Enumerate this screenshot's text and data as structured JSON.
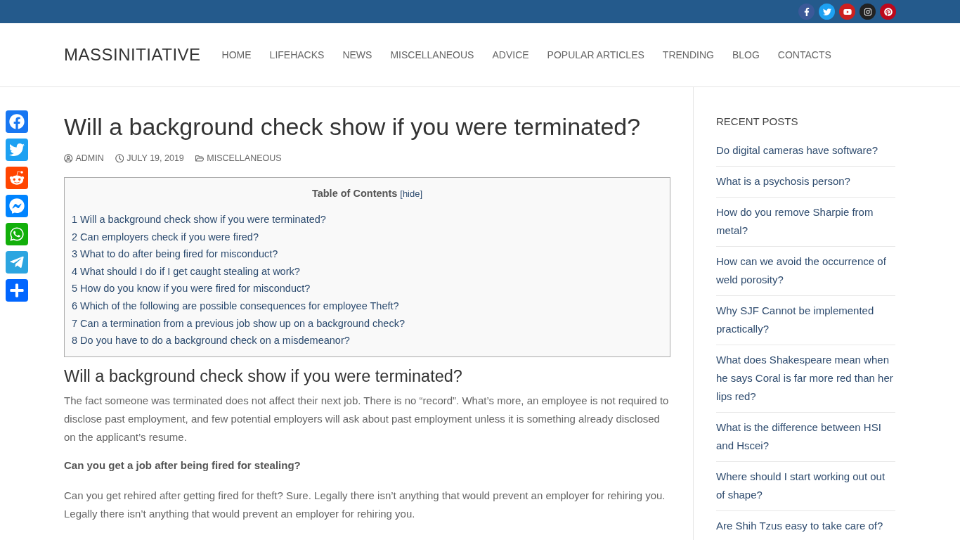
{
  "top_bar": {
    "social_links": [
      {
        "kind": "facebook"
      },
      {
        "kind": "twitter"
      },
      {
        "kind": "youtube"
      },
      {
        "kind": "instagram"
      },
      {
        "kind": "pinterest"
      }
    ]
  },
  "header": {
    "logo": "MASSINITIATIVE",
    "nav": [
      "HOME",
      "LIFEHACKS",
      "NEWS",
      "MISCELLANEOUS",
      "ADVICE",
      "POPULAR ARTICLES",
      "TRENDING",
      "BLOG",
      "CONTACTS"
    ]
  },
  "share_bar": [
    {
      "kind": "facebook"
    },
    {
      "kind": "twitter"
    },
    {
      "kind": "reddit"
    },
    {
      "kind": "messenger"
    },
    {
      "kind": "whatsapp"
    },
    {
      "kind": "telegram"
    },
    {
      "kind": "share"
    }
  ],
  "article": {
    "title": "Will a background check show if you were terminated?",
    "meta": [
      {
        "kind": "author",
        "text": "ADMIN"
      },
      {
        "kind": "date",
        "text": "JULY 19, 2019"
      },
      {
        "kind": "category",
        "text": "MISCELLANEOUS"
      }
    ],
    "toc": {
      "title": "Table of Contents",
      "toggle": "[hide]",
      "items": [
        "1 Will a background check show if you were terminated?",
        "2 Can employers check if you were fired?",
        "3 What to do after being fired for misconduct?",
        "4 What should I do if I get caught stealing at work?",
        "5 How do you know if you were fired for misconduct?",
        "6 Which of the following are possible consequences for employee Theft?",
        "7 Can a termination from a previous job show up on a background check?",
        "8 Do you have to do a background check on a misdemeanor?"
      ]
    },
    "heading": "Will a background check show if you were terminated?",
    "blocks": [
      {
        "kind": "paragraph",
        "text": "The fact someone was terminated does not affect their next job. There is no “record”. What’s more, an employee is not required to disclose past employment, and few potential employers will ask about past employment unless it is something already disclosed on the applicant’s resume."
      },
      {
        "kind": "question",
        "text": "Can you get a job after being fired for stealing?"
      },
      {
        "kind": "paragraph",
        "text": "Can you get rehired after getting fired for theft? Sure. Legally there isn’t anything that would prevent an employer for rehiring you. Legally there isn’t anything that would prevent an employer for rehiring you."
      }
    ]
  },
  "sidebar": {
    "title": "RECENT POSTS",
    "posts": [
      "Do digital cameras have software?",
      "What is a psychosis person?",
      "How do you remove Sharpie from metal?",
      "How can we avoid the occurrence of weld porosity?",
      "Why SJF Cannot be implemented practically?",
      "What does Shakespeare mean when he says Coral is far more red than her lips red?",
      "What is the difference between HSI and Hscei?",
      "Where should I start working out out of shape?",
      "Are Shih Tzus easy to take care of?"
    ]
  }
}
